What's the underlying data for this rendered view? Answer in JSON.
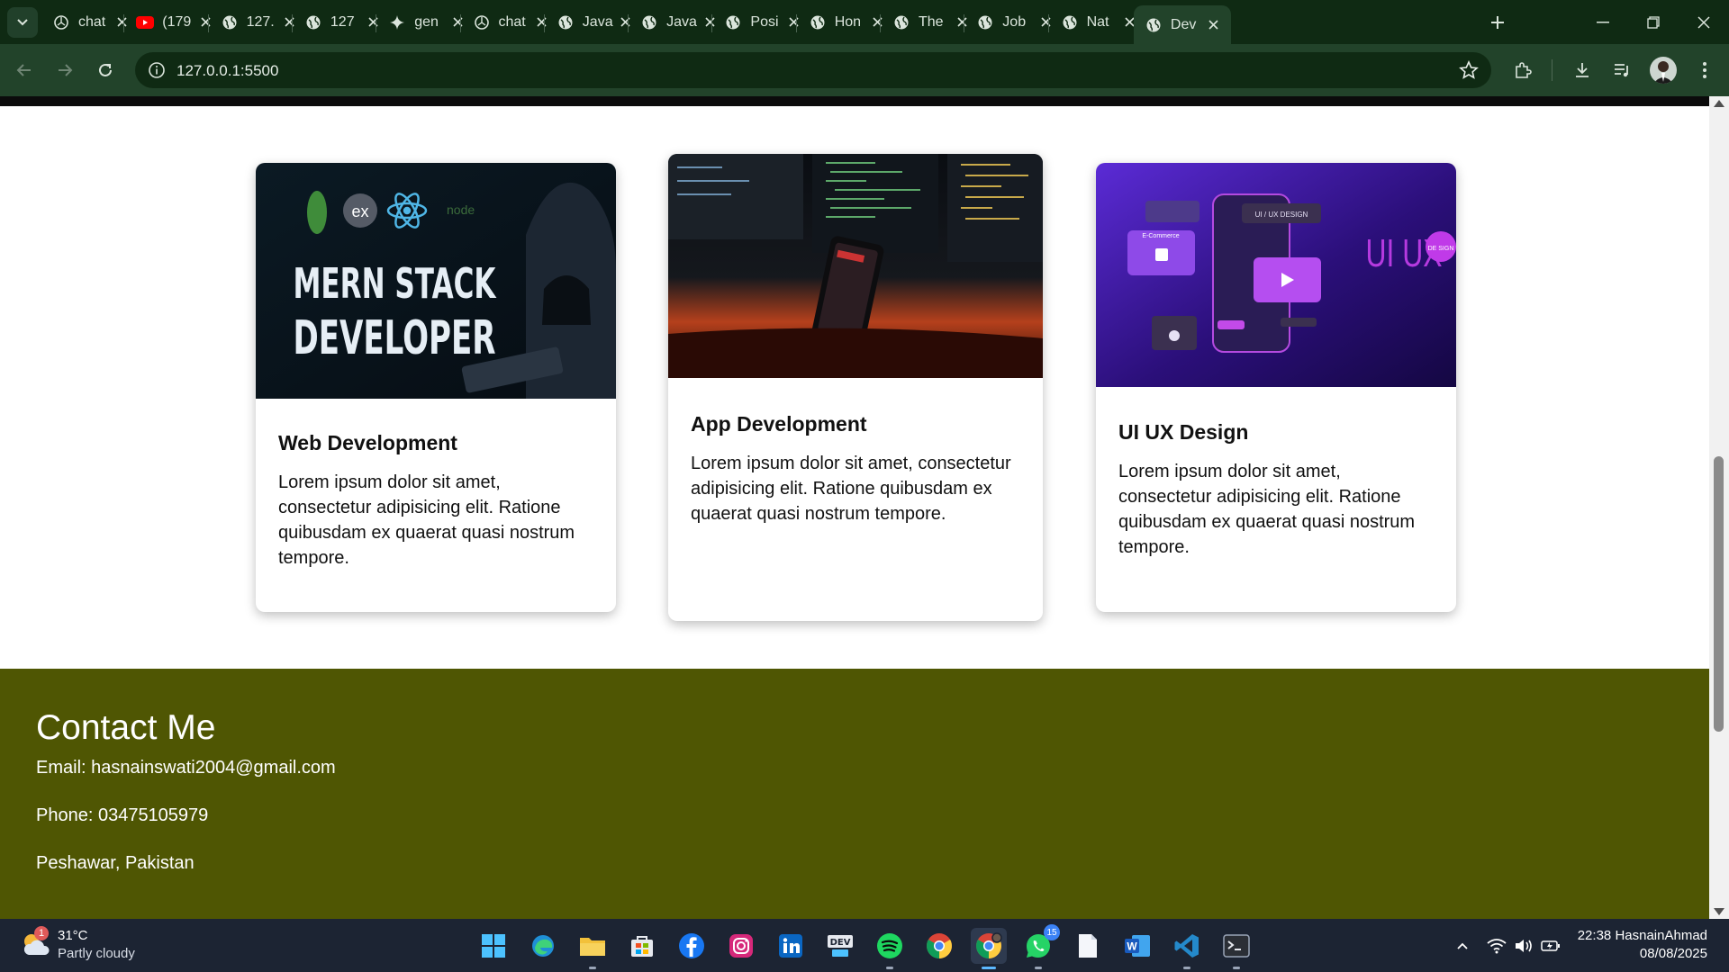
{
  "browser": {
    "tabs": [
      {
        "title": "chat",
        "favicon": "openai-icon"
      },
      {
        "title": "(179",
        "favicon": "youtube-icon"
      },
      {
        "title": "127.",
        "favicon": "globe-icon"
      },
      {
        "title": "127",
        "favicon": "globe-icon"
      },
      {
        "title": "gen",
        "favicon": "gemini-icon"
      },
      {
        "title": "chat",
        "favicon": "openai-icon"
      },
      {
        "title": "Java",
        "favicon": "globe-icon"
      },
      {
        "title": "Java",
        "favicon": "globe-icon"
      },
      {
        "title": "Posi",
        "favicon": "globe-icon"
      },
      {
        "title": "Hon",
        "favicon": "globe-icon"
      },
      {
        "title": "The",
        "favicon": "globe-icon"
      },
      {
        "title": "Job",
        "favicon": "globe-icon"
      },
      {
        "title": "Nat",
        "favicon": "globe-icon"
      },
      {
        "title": "Dev",
        "favicon": "globe-icon",
        "active": true
      }
    ],
    "url": "127.0.0.1:5500"
  },
  "services": {
    "cards": [
      {
        "image_text_line1": "MERN STACK",
        "image_text_line2": "DEVELOPER",
        "title": "Web Development",
        "text": "Lorem ipsum dolor sit amet, consectetur adipisicing elit. Ratione quibusdam ex quaerat quasi nostrum tempore."
      },
      {
        "title": "App Development",
        "text": "Lorem ipsum dolor sit amet, consectetur adipisicing elit. Ratione quibusdam ex quaerat quasi nostrum tempore."
      },
      {
        "image_text_big": "UI UX",
        "image_text_small": "DE SIGN",
        "image_label1": "UI / UX DESIGN",
        "image_label2": "E-Commerce",
        "title": "UI UX Design",
        "text": "Lorem ipsum dolor sit amet, consectetur adipisicing elit. Ratione quibusdam ex quaerat quasi nostrum tempore."
      }
    ]
  },
  "contact": {
    "heading": "Contact Me",
    "email": "Email: hasnainswati2004@gmail.com",
    "phone": "Phone: 03475105979",
    "address": "Peshawar, Pakistan"
  },
  "taskbar": {
    "weather": {
      "temp": "31°C",
      "condition": "Partly cloudy",
      "badge": "1"
    },
    "apps": [
      "windows-start-icon",
      "edge-icon",
      "file-explorer-icon",
      "store-icon",
      "facebook-icon",
      "instagram-icon",
      "linkedin-icon",
      "dev-icon",
      "spotify-icon",
      "chrome-icon",
      "chrome-profile-icon",
      "whatsapp-icon",
      "notepad-icon",
      "word-icon",
      "vscode-icon",
      "terminal-icon"
    ],
    "whatsapp_badge": "15",
    "clock_time": "22:38",
    "clock_user": "HasnainAhmad",
    "clock_date": "08/08/2025"
  },
  "colors": {
    "chrome_dark": "#0f2a13",
    "chrome_toolbar": "#22432a",
    "footer_bg": "#4f5603",
    "taskbar_bg": "#1c2433"
  }
}
